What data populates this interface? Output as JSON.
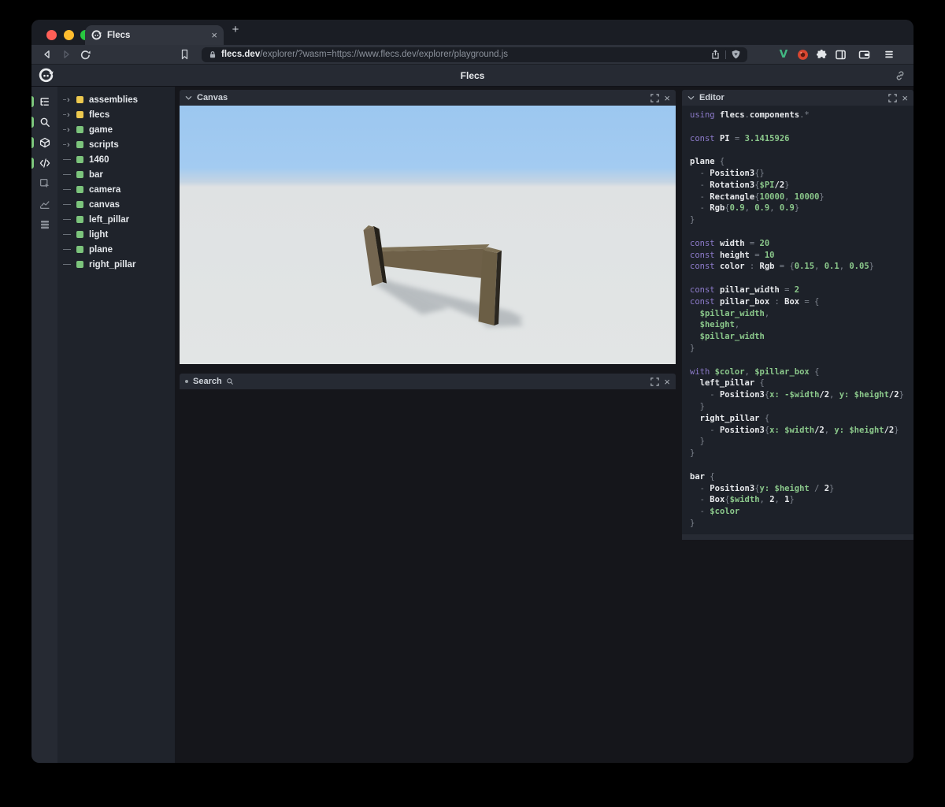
{
  "browser": {
    "traffic_lights": [
      "#ff5f57",
      "#febc2e",
      "#28c840"
    ],
    "tab": {
      "title": "Flecs",
      "close_label": "×",
      "favicon": "flecs-logo-icon"
    },
    "new_tab_label": "+",
    "nav_icons": [
      "back-icon",
      "forward-icon",
      "reload-icon",
      "bookmark-icon"
    ],
    "url": {
      "lock_icon": "lock-icon",
      "domain": "flecs.dev",
      "path": "/explorer/?wasm=https://www.flecs.dev/explorer/playground.js",
      "trailing_icons": [
        "share-icon",
        "brave-shield-icon"
      ]
    },
    "extension_icons": [
      "vue-extension-icon",
      "red-extension-icon",
      "puzzle-extensions-icon",
      "sidebar-icon",
      "wallet-icon",
      "menu-icon"
    ]
  },
  "app": {
    "header": {
      "title": "Flecs",
      "logo_icon": "flecs-logo-icon",
      "right_icon": "link-icon"
    },
    "sidebar_icons": [
      {
        "name": "tree-icon",
        "active": true
      },
      {
        "name": "search-icon",
        "active": true
      },
      {
        "name": "cube-icon",
        "active": true
      },
      {
        "name": "code-icon",
        "active": true
      },
      {
        "name": "inspect-icon",
        "active": false
      },
      {
        "name": "chart-icon",
        "active": false
      },
      {
        "name": "stats-icon",
        "active": false
      }
    ],
    "tree": {
      "items": [
        {
          "label": "assemblies",
          "color": "#edc94f",
          "expandable": true
        },
        {
          "label": "flecs",
          "color": "#edc94f",
          "expandable": true
        },
        {
          "label": "game",
          "color": "#7cc47c",
          "expandable": true
        },
        {
          "label": "scripts",
          "color": "#7cc47c",
          "expandable": true
        },
        {
          "label": "1460",
          "color": "#7cc47c",
          "expandable": false
        },
        {
          "label": "bar",
          "color": "#7cc47c",
          "expandable": false
        },
        {
          "label": "camera",
          "color": "#7cc47c",
          "expandable": false
        },
        {
          "label": "canvas",
          "color": "#7cc47c",
          "expandable": false
        },
        {
          "label": "left_pillar",
          "color": "#7cc47c",
          "expandable": false
        },
        {
          "label": "light",
          "color": "#7cc47c",
          "expandable": false
        },
        {
          "label": "plane",
          "color": "#7cc47c",
          "expandable": false
        },
        {
          "label": "right_pillar",
          "color": "#7cc47c",
          "expandable": false
        }
      ]
    },
    "panels": {
      "canvas": {
        "title": "Canvas",
        "close_label": "×"
      },
      "search": {
        "title": "Search",
        "close_label": "×"
      },
      "editor": {
        "title": "Editor",
        "close_label": "×"
      }
    },
    "scene": {
      "sky_color": "#9cc7f0",
      "ground_color": "#e2e5e5",
      "object_colors": {
        "front": "#6e6048",
        "light": "#746650",
        "top": "#7d7055",
        "dark_side": "#25211a",
        "shadow": "#8e959b"
      }
    },
    "editor_code": {
      "colors": {
        "k": "#8d7bcb",
        "i": "#e8eaed",
        "p": "#7d838d",
        "v": "#8bc88b"
      },
      "lines": [
        [
          [
            "k",
            "using "
          ],
          [
            "i",
            "flecs"
          ],
          [
            "p",
            "."
          ],
          [
            "i",
            "components"
          ],
          [
            "p",
            "."
          ],
          [
            "p",
            "*"
          ]
        ],
        [],
        [
          [
            "k",
            "const "
          ],
          [
            "i",
            "PI"
          ],
          [
            "p",
            " = "
          ],
          [
            "v",
            "3.1415926"
          ]
        ],
        [],
        [
          [
            "i",
            "plane"
          ],
          [
            "p",
            " {"
          ]
        ],
        [
          [
            "p",
            "  - "
          ],
          [
            "i",
            "Position3"
          ],
          [
            "p",
            "{}"
          ]
        ],
        [
          [
            "p",
            "  - "
          ],
          [
            "i",
            "Rotation3"
          ],
          [
            "p",
            "{"
          ],
          [
            "v",
            "$PI"
          ],
          [
            "i",
            "/2"
          ],
          [
            "p",
            "}"
          ]
        ],
        [
          [
            "p",
            "  - "
          ],
          [
            "i",
            "Rectangle"
          ],
          [
            "p",
            "{"
          ],
          [
            "v",
            "10000"
          ],
          [
            "p",
            ", "
          ],
          [
            "v",
            "10000"
          ],
          [
            "p",
            "}"
          ]
        ],
        [
          [
            "p",
            "  - "
          ],
          [
            "i",
            "Rgb"
          ],
          [
            "p",
            "{"
          ],
          [
            "v",
            "0.9"
          ],
          [
            "p",
            ", "
          ],
          [
            "v",
            "0.9"
          ],
          [
            "p",
            ", "
          ],
          [
            "v",
            "0.9"
          ],
          [
            "p",
            "}"
          ]
        ],
        [
          [
            "p",
            "}"
          ]
        ],
        [],
        [
          [
            "k",
            "const "
          ],
          [
            "i",
            "width"
          ],
          [
            "p",
            " = "
          ],
          [
            "v",
            "20"
          ]
        ],
        [
          [
            "k",
            "const "
          ],
          [
            "i",
            "height"
          ],
          [
            "p",
            " = "
          ],
          [
            "v",
            "10"
          ]
        ],
        [
          [
            "k",
            "const "
          ],
          [
            "i",
            "color"
          ],
          [
            "p",
            " : "
          ],
          [
            "i",
            "Rgb"
          ],
          [
            "p",
            " = {"
          ],
          [
            "v",
            "0.15"
          ],
          [
            "p",
            ", "
          ],
          [
            "v",
            "0.1"
          ],
          [
            "p",
            ", "
          ],
          [
            "v",
            "0.05"
          ],
          [
            "p",
            "}"
          ]
        ],
        [],
        [
          [
            "k",
            "const "
          ],
          [
            "i",
            "pillar_width"
          ],
          [
            "p",
            " = "
          ],
          [
            "v",
            "2"
          ]
        ],
        [
          [
            "k",
            "const "
          ],
          [
            "i",
            "pillar_box"
          ],
          [
            "p",
            " : "
          ],
          [
            "i",
            "Box"
          ],
          [
            "p",
            " = {"
          ]
        ],
        [
          [
            "v",
            "  $pillar_width"
          ],
          [
            "p",
            ","
          ]
        ],
        [
          [
            "v",
            "  $height"
          ],
          [
            "p",
            ","
          ]
        ],
        [
          [
            "v",
            "  $pillar_width"
          ]
        ],
        [
          [
            "p",
            "}"
          ]
        ],
        [],
        [
          [
            "k",
            "with "
          ],
          [
            "v",
            "$color"
          ],
          [
            "p",
            ", "
          ],
          [
            "v",
            "$pillar_box"
          ],
          [
            "p",
            " {"
          ]
        ],
        [
          [
            "i",
            "  left_pillar"
          ],
          [
            "p",
            " {"
          ]
        ],
        [
          [
            "p",
            "    - "
          ],
          [
            "i",
            "Position3"
          ],
          [
            "p",
            "{"
          ],
          [
            "v",
            "x: -$width"
          ],
          [
            "i",
            "/2"
          ],
          [
            "p",
            ", "
          ],
          [
            "v",
            "y: $height"
          ],
          [
            "i",
            "/2"
          ],
          [
            "p",
            "}"
          ]
        ],
        [
          [
            "p",
            "  }"
          ]
        ],
        [
          [
            "i",
            "  right_pillar"
          ],
          [
            "p",
            " {"
          ]
        ],
        [
          [
            "p",
            "    - "
          ],
          [
            "i",
            "Position3"
          ],
          [
            "p",
            "{"
          ],
          [
            "v",
            "x: $width"
          ],
          [
            "i",
            "/2"
          ],
          [
            "p",
            ", "
          ],
          [
            "v",
            "y: $height"
          ],
          [
            "i",
            "/2"
          ],
          [
            "p",
            "}"
          ]
        ],
        [
          [
            "p",
            "  }"
          ]
        ],
        [
          [
            "p",
            "}"
          ]
        ],
        [],
        [
          [
            "i",
            "bar"
          ],
          [
            "p",
            " {"
          ]
        ],
        [
          [
            "p",
            "  - "
          ],
          [
            "i",
            "Position3"
          ],
          [
            "p",
            "{"
          ],
          [
            "v",
            "y: $height"
          ],
          [
            "p",
            " / "
          ],
          [
            "i",
            "2"
          ],
          [
            "p",
            "}"
          ]
        ],
        [
          [
            "p",
            "  - "
          ],
          [
            "i",
            "Box"
          ],
          [
            "p",
            "{"
          ],
          [
            "v",
            "$width"
          ],
          [
            "p",
            ", "
          ],
          [
            "i",
            "2"
          ],
          [
            "p",
            ", "
          ],
          [
            "i",
            "1"
          ],
          [
            "p",
            "}"
          ]
        ],
        [
          [
            "p",
            "  - "
          ],
          [
            "v",
            "$color"
          ]
        ],
        [
          [
            "p",
            "}"
          ]
        ]
      ]
    }
  }
}
